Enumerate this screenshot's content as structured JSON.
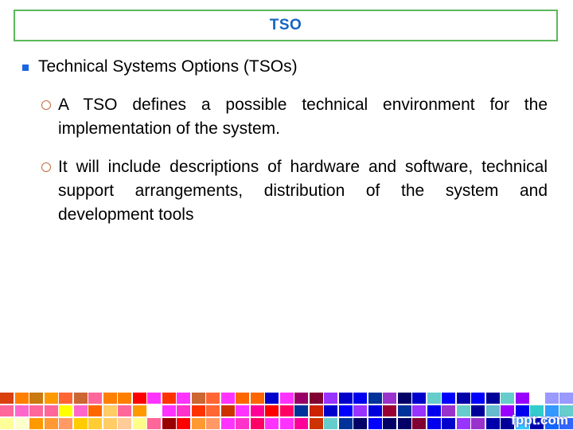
{
  "slide": {
    "title": "TSO",
    "bullet_main": "Technical Systems Options (TSOs)",
    "sub_bullets": [
      "A TSO defines a possible technical environment for the implementation of the system.",
      "It will include descriptions of hardware and software, technical support arrangements, distribution of the system and development tools"
    ]
  },
  "colors": {
    "title_border": "#5cb85c",
    "title_text": "#1565c0",
    "square_bullet": "#1a66e0",
    "circle_bullet": "#c26a3a"
  },
  "footer": {
    "watermark": "fppt.com",
    "mosaic_rows": [
      [
        "#d9400e",
        "#ff7f00",
        "#c97a10",
        "#ff9900",
        "#ff6633",
        "#cc6633",
        "#ff6699",
        "#ff7f00",
        "#ff8000",
        "#ff0000",
        "#ff33ff",
        "#ff3300",
        "#ff33ff",
        "#cc6633",
        "#ff6633",
        "#ff33ff",
        "#ff6600",
        "#ff6600",
        "#0000cc",
        "#ff33ff",
        "#990066",
        "#800033",
        "#9933ff",
        "#0000cc",
        "#0000ee",
        "#003399",
        "#9933cc",
        "#000066",
        "#0000cc",
        "#66cccc",
        "#0000ff",
        "#0000aa",
        "#0000ff",
        "#000099",
        "#66cccc",
        "#9900ff",
        "#ffffff",
        "#9999ff",
        "#9999ff",
        "#9999ee"
      ],
      [
        "#ff6699",
        "#ff66cc",
        "#ff6699",
        "#ff6699",
        "#ffff00",
        "#ff66cc",
        "#ff6600",
        "#ffcc66",
        "#ff6699",
        "#ff9900",
        "#ffffff",
        "#ff33ff",
        "#ff33cc",
        "#ff3300",
        "#ff6633",
        "#cc3300",
        "#ff33ff",
        "#ff0099",
        "#ff0000",
        "#ff0066",
        "#003399",
        "#cc2200",
        "#0000cc",
        "#0000ff",
        "#9933ff",
        "#0000dd",
        "#990033",
        "#003399",
        "#9933ff",
        "#0000ee",
        "#9933cc",
        "#66cccc",
        "#000099",
        "#66bbcc",
        "#9900ff",
        "#0000ee",
        "#33cccc",
        "#3399ff",
        "#66cccc",
        "#66cccc"
      ],
      [
        "#ffff99",
        "#ffffcc",
        "#ff9900",
        "#ff9933",
        "#ff9966",
        "#ffcc00",
        "#ffcc33",
        "#ffcc66",
        "#ffcc99",
        "#ffff88",
        "#ff6699",
        "#990000",
        "#ff0000",
        "#ff9933",
        "#ff9966",
        "#ff33ff",
        "#ff33cc",
        "#ff0066",
        "#ff33ff",
        "#ff33ff",
        "#ff0099",
        "#cc3300",
        "#66cccc",
        "#003399",
        "#000066",
        "#0000ff",
        "#000066",
        "#000066",
        "#800033",
        "#0000ee",
        "#0000cc",
        "#9933ff",
        "#9933cc",
        "#0000aa",
        "#000099",
        "#33ccff",
        "#0000aa",
        "#1166ff",
        "#3366ff",
        "#3366ff"
      ]
    ]
  }
}
